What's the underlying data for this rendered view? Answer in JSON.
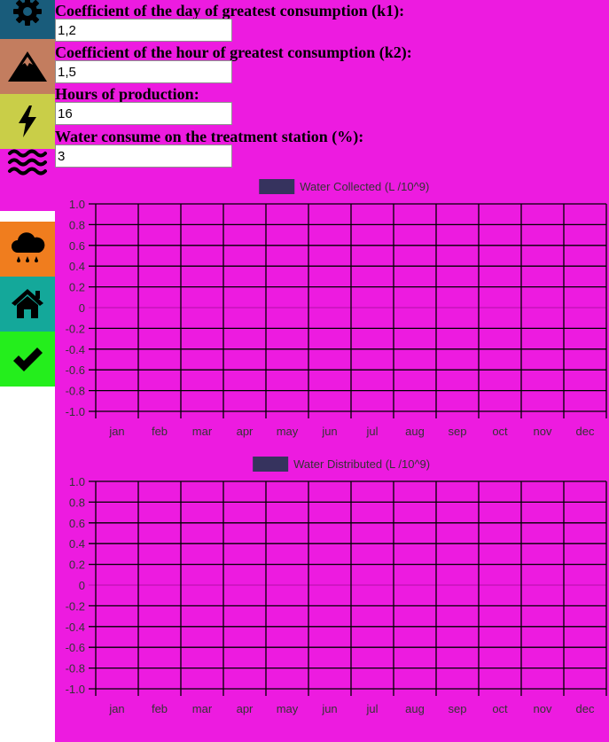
{
  "sidebar": {
    "items": [
      {
        "name": "settings",
        "icon": "gear-icon",
        "color": "#195c7b",
        "icon_color": "#000000"
      },
      {
        "name": "mountain",
        "icon": "mountain-icon",
        "color": "#c37d5f",
        "icon_color": "#000000"
      },
      {
        "name": "energy",
        "icon": "lightning-icon",
        "color": "#c9ce48",
        "icon_color": "#000000"
      },
      {
        "name": "water",
        "icon": "water-waves-icon",
        "color": "#ed1be0",
        "icon_color": "#000000"
      },
      {
        "name": "rain",
        "icon": "cloud-rain-icon",
        "color": "#f07d1e",
        "icon_color": "#000000"
      },
      {
        "name": "home",
        "icon": "home-icon",
        "color": "#14a89a",
        "icon_color": "#000000"
      },
      {
        "name": "validate",
        "icon": "checkmark-icon",
        "color": "#24ee1c",
        "icon_color": "#000000"
      }
    ]
  },
  "form": {
    "k1_label": "Coefficient of the day of greatest consumption (k1):",
    "k1_value": "1,2",
    "k2_label": "Coefficient of the hour of greatest consumption (k2):",
    "k2_value": "1,5",
    "hours_label": "Hours of production:",
    "hours_value": "16",
    "treatment_label": "Water consume on the treatment station (%):",
    "treatment_value": "3"
  },
  "colors": {
    "page_background": "#ed1be0",
    "legend_swatch": "#36335e",
    "grid": "#000000"
  },
  "chart_data": [
    {
      "type": "line",
      "categories": [
        "jan",
        "feb",
        "mar",
        "apr",
        "may",
        "jun",
        "jul",
        "aug",
        "sep",
        "oct",
        "nov",
        "dec"
      ],
      "series": [
        {
          "name": "Water Collected (L /10^9)",
          "values": []
        }
      ],
      "yticks": [
        "1.0",
        "0.8",
        "0.6",
        "0.4",
        "0.2",
        "0",
        "-0.2",
        "-0.4",
        "-0.6",
        "-0.8",
        "-1.0"
      ],
      "ylim": [
        -1,
        1
      ],
      "grid": true,
      "legend_position": "top-center"
    },
    {
      "type": "line",
      "categories": [
        "jan",
        "feb",
        "mar",
        "apr",
        "may",
        "jun",
        "jul",
        "aug",
        "sep",
        "oct",
        "nov",
        "dec"
      ],
      "series": [
        {
          "name": "Water Distributed (L /10^9)",
          "values": []
        }
      ],
      "yticks": [
        "1.0",
        "0.8",
        "0.6",
        "0.4",
        "0.2",
        "0",
        "-0.2",
        "-0.4",
        "-0.6",
        "-0.8",
        "-1.0"
      ],
      "ylim": [
        -1,
        1
      ],
      "grid": true,
      "legend_position": "top-center"
    }
  ]
}
